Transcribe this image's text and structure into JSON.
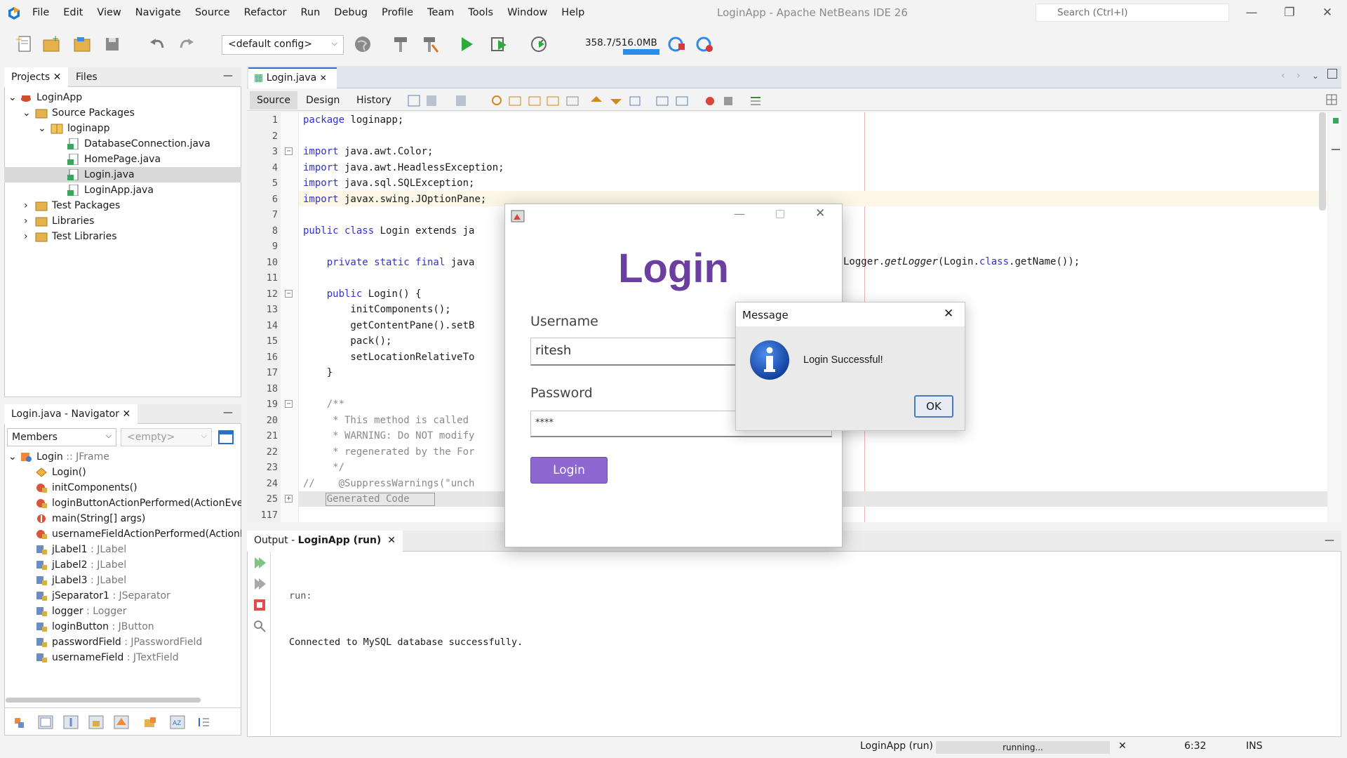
{
  "window": {
    "title": "LoginApp - Apache NetBeans IDE 26",
    "search_placeholder": "Search (Ctrl+I)"
  },
  "menu": [
    "File",
    "Edit",
    "View",
    "Navigate",
    "Source",
    "Refactor",
    "Run",
    "Debug",
    "Profile",
    "Team",
    "Tools",
    "Window",
    "Help"
  ],
  "toolbar": {
    "config": "<default config>",
    "memory": "358.7/516.0MB"
  },
  "projects": {
    "tab_projects": "Projects",
    "tab_files": "Files",
    "tree": [
      {
        "label": "LoginApp",
        "icon": "coffee-cup-icon"
      },
      {
        "label": "Source Packages",
        "icon": "folder-icon"
      },
      {
        "label": "loginapp",
        "icon": "package-icon"
      },
      {
        "label": "DatabaseConnection.java",
        "icon": "java-file-icon"
      },
      {
        "label": "HomePage.java",
        "icon": "java-file-icon"
      },
      {
        "label": "Login.java",
        "icon": "java-file-icon"
      },
      {
        "label": "LoginApp.java",
        "icon": "java-file-icon"
      },
      {
        "label": "Test Packages",
        "icon": "folder-icon"
      },
      {
        "label": "Libraries",
        "icon": "folder-icon"
      },
      {
        "label": "Test Libraries",
        "icon": "folder-icon"
      }
    ]
  },
  "navigator": {
    "title": "Login.java - Navigator",
    "members_select": "Members",
    "filter_select": "<empty>",
    "root": {
      "name": "Login",
      "type": " :: JFrame"
    },
    "items": [
      {
        "name": "Login()",
        "type": ""
      },
      {
        "name": "initComponents()",
        "type": ""
      },
      {
        "name": "loginButtonActionPerformed(ActionEve",
        "type": ""
      },
      {
        "name": "main(String[] args)",
        "type": ""
      },
      {
        "name": "usernameFieldActionPerformed(ActionE",
        "type": ""
      },
      {
        "name": "jLabel1",
        "type": " : JLabel"
      },
      {
        "name": "jLabel2",
        "type": " : JLabel"
      },
      {
        "name": "jLabel3",
        "type": " : JLabel"
      },
      {
        "name": "jSeparator1",
        "type": " : JSeparator"
      },
      {
        "name": "logger",
        "type": " : Logger"
      },
      {
        "name": "loginButton",
        "type": " : JButton"
      },
      {
        "name": "passwordField",
        "type": " : JPasswordField"
      },
      {
        "name": "usernameField",
        "type": " : JTextField"
      }
    ]
  },
  "editor": {
    "tab": "Login.java",
    "subtabs": [
      "Source",
      "Design",
      "History"
    ],
    "line_numbers": [
      "1",
      "2",
      "3",
      "4",
      "5",
      "6",
      "7",
      "8",
      "9",
      "10",
      "11",
      "12",
      "13",
      "14",
      "15",
      "16",
      "17",
      "18",
      "19",
      "20",
      "21",
      "22",
      "23",
      "24",
      "25",
      "117"
    ],
    "lines": [
      {
        "kw": "package",
        "rest": " loginapp;"
      },
      {
        "kw": "",
        "rest": ""
      },
      {
        "kw": "import",
        "rest": " java.awt.Color;"
      },
      {
        "kw": "import",
        "rest": " java.awt.HeadlessException;"
      },
      {
        "kw": "import",
        "rest": " java.sql.SQLException;"
      },
      {
        "kw": "import",
        "rest": " javax.swing.JOptionPane;"
      },
      {
        "kw": "",
        "rest": ""
      },
      {
        "kw": "public class",
        "rest": " Login extends ja"
      },
      {
        "kw": "",
        "rest": ""
      },
      {
        "kw": "    private static final",
        "rest": " java"
      },
      {
        "kw": "",
        "rest": ""
      },
      {
        "kw": "    public",
        "rest": " Login() {"
      },
      {
        "kw": "",
        "rest": "        initComponents();"
      },
      {
        "kw": "",
        "rest": "        getContentPane().setB"
      },
      {
        "kw": "",
        "rest": "        pack();"
      },
      {
        "kw": "",
        "rest": "        setLocationRelativeTo"
      },
      {
        "kw": "",
        "rest": "    }"
      },
      {
        "kw": "",
        "rest": ""
      },
      {
        "kw": "",
        "rest": "    /**"
      },
      {
        "kw": "",
        "rest": "     * This method is called"
      },
      {
        "kw": "",
        "rest": "     * WARNING: Do NOT modify"
      },
      {
        "kw": "",
        "rest": "     * regenerated by the For"
      },
      {
        "kw": "",
        "rest": "     */"
      },
      {
        "kw": "",
        "rest": "//    @SuppressWarnings(\"unch"
      },
      {
        "kw": "",
        "rest": "    Generated Code"
      },
      {
        "kw": "",
        "rest": ""
      }
    ],
    "line10_tail_a": "Logger.",
    "line10_tail_b": "getLogger",
    "line10_tail_c": "(Login.",
    "line10_tail_d": "class",
    "line10_tail_e": ".getName());"
  },
  "login_window": {
    "heading": "Login",
    "username_label": "Username",
    "username_value": "ritesh",
    "password_label": "Password",
    "password_value": "****",
    "button": "Login"
  },
  "message_dialog": {
    "title": "Message",
    "text": "Login Successful!",
    "ok": "OK"
  },
  "output": {
    "title_prefix": "Output - ",
    "title_bold": "LoginApp (run)",
    "lines": [
      "run:",
      "Connected to MySQL database successfully."
    ]
  },
  "statusbar": {
    "task": "LoginApp (run)",
    "progress": "running...",
    "position": "6:32",
    "mode": "INS"
  },
  "colors": {
    "accent": "#6a3fa0",
    "button": "#8e67d1",
    "keyword": "#3333cc",
    "info": "#1f5cc5"
  }
}
